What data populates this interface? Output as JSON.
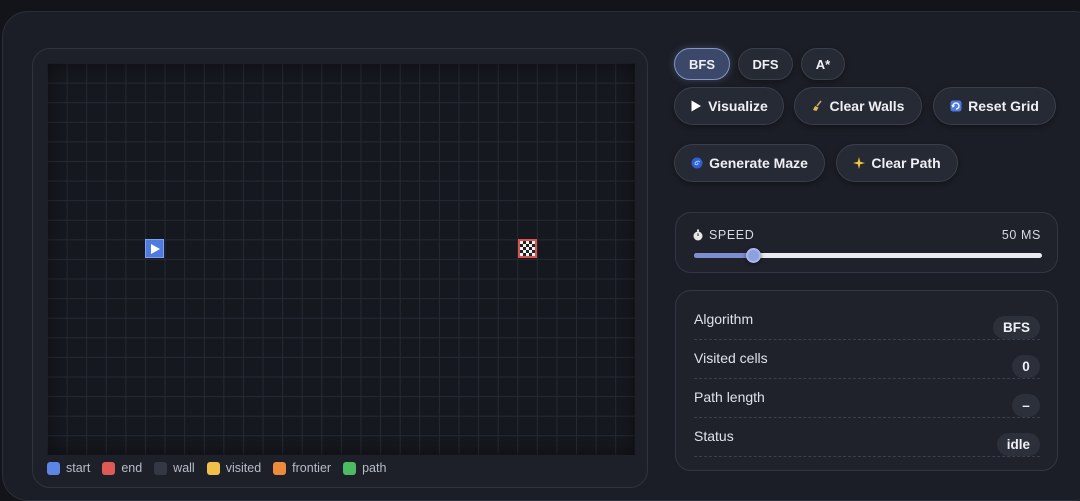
{
  "algorithms": [
    {
      "label": "BFS",
      "active": true
    },
    {
      "label": "DFS",
      "active": false
    },
    {
      "label": "A*",
      "active": false
    }
  ],
  "actions": {
    "visualize": {
      "label": "Visualize",
      "icon": "play-icon"
    },
    "clear_walls": {
      "label": "Clear Walls",
      "icon": "broom-icon"
    },
    "reset_grid": {
      "label": "Reset Grid",
      "icon": "refresh-icon"
    },
    "generate_maze": {
      "label": "Generate Maze",
      "icon": "spiral-icon"
    },
    "clear_path": {
      "label": "Clear Path",
      "icon": "sparkles-icon"
    }
  },
  "speed": {
    "label": "SPEED",
    "icon": "stopwatch-icon",
    "value_text": "50 MS",
    "level": 0.17
  },
  "stats": [
    {
      "label": "Algorithm",
      "value": "BFS"
    },
    {
      "label": "Visited cells",
      "value": "0"
    },
    {
      "label": "Path length",
      "value": "–"
    },
    {
      "label": "Status",
      "value": "idle"
    }
  ],
  "legend": [
    {
      "label": "start",
      "color": "#5b86e5"
    },
    {
      "label": "end",
      "color": "#e05a55"
    },
    {
      "label": "wall",
      "color": "#343844"
    },
    {
      "label": "visited",
      "color": "#f0c04a"
    },
    {
      "label": "frontier",
      "color": "#ee8a3c"
    },
    {
      "label": "path",
      "color": "#4cbb62"
    }
  ],
  "grid": {
    "start_icon": "play-icon",
    "end_icon": "checkered-flag-icon"
  }
}
